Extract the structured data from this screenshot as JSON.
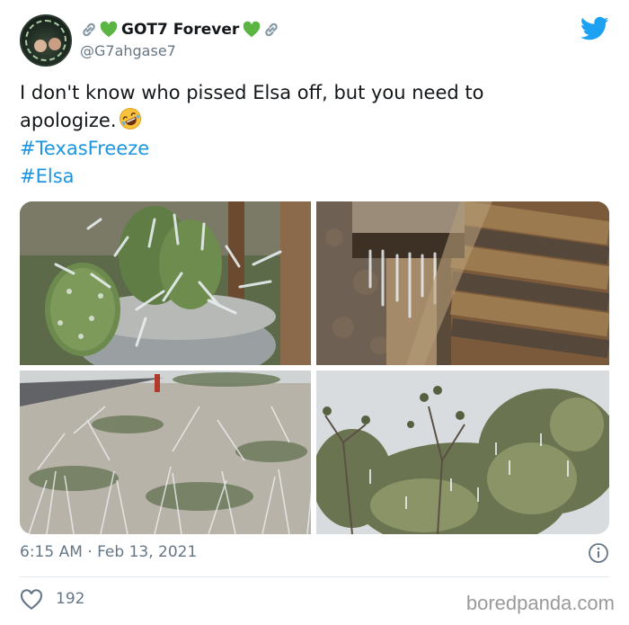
{
  "author": {
    "display_name": "GOT7 Forever",
    "handle": "@G7ahgase7",
    "name_decorations": [
      "link-icon",
      "green-heart-icon",
      "green-heart-icon",
      "link-icon"
    ]
  },
  "tweet": {
    "text_line1": "I don't know who pissed Elsa off, but you need to",
    "text_line2": "apologize.",
    "hashtags": [
      "#TexasFreeze",
      "#Elsa"
    ],
    "emoji": "rolling-on-floor-laughing-icon"
  },
  "media": {
    "photos": [
      "frozen-cactus-photo",
      "frozen-fence-post-photo",
      "frozen-grass-photo",
      "frozen-shrub-photo"
    ]
  },
  "footer": {
    "timestamp": "6:15 AM · Feb 13, 2021",
    "like_count": "192"
  },
  "watermark": "boredpanda.com",
  "colors": {
    "twitter_blue": "#1da1f2",
    "hashtag_blue": "#1b95e0",
    "muted_text": "#657786",
    "heart_green": "#5bb543"
  }
}
